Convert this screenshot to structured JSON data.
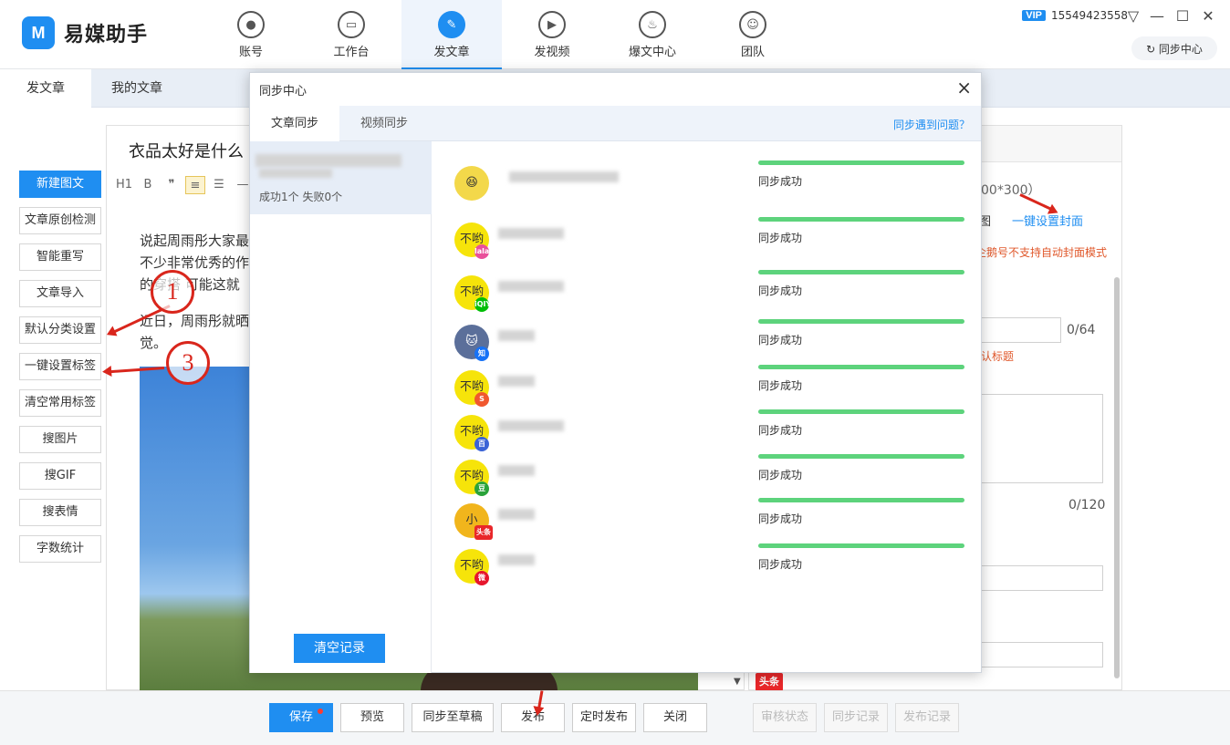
{
  "app": {
    "logo_mark": "M",
    "name": "易媒助手"
  },
  "nav": [
    {
      "label": "账号",
      "icon": "user-icon",
      "glyph": "●",
      "active": false
    },
    {
      "label": "工作台",
      "icon": "monitor-icon",
      "glyph": "▭",
      "active": false
    },
    {
      "label": "发文章",
      "icon": "feather-icon",
      "glyph": "✎",
      "active": true
    },
    {
      "label": "发视频",
      "icon": "play-icon",
      "glyph": "▶",
      "active": false
    },
    {
      "label": "爆文中心",
      "icon": "flame-icon",
      "glyph": "♨",
      "active": false
    },
    {
      "label": "团队",
      "icon": "team-icon",
      "glyph": "☺",
      "active": false
    }
  ],
  "account": {
    "vip": "VIP",
    "phone": "15549423558"
  },
  "window": {
    "menu": "▽",
    "minimize": "—",
    "maximize": "☐",
    "close": "✕"
  },
  "sync_center_button": "↻ 同步中心",
  "subtabs": [
    "发文章",
    "我的文章"
  ],
  "tools": [
    "新建图文",
    "文章原创检测",
    "智能重写",
    "文章导入",
    "默认分类设置",
    "一键设置标签",
    "清空常用标签",
    "搜图片",
    "搜GIF",
    "搜表情",
    "字数统计"
  ],
  "editor": {
    "title": "衣品太好是什么",
    "toolbar": [
      "H1",
      "B",
      "❞",
      "≡",
      "☰",
      "—",
      "▢"
    ],
    "para1": [
      "说起周雨彤大家最",
      "不少非常优秀的作",
      "的穿搭 可能这就"
    ],
    "para2": [
      "近日，周雨彤就晒",
      "觉。"
    ]
  },
  "right_panel": {
    "cover_size": "00*300）",
    "cover_tu": "图",
    "cover_link": "一键设置封面",
    "cover_warn": "企鹅号不支持自动封面模式",
    "title_count": "0/64",
    "title_hint": "认标题",
    "summary_count": "0/120",
    "toutiao": "头条"
  },
  "bottom": {
    "save": "保存",
    "preview": "预览",
    "sync_draft": "同步至草稿",
    "publish": "发布",
    "schedule": "定时发布",
    "close": "关闭",
    "review": "审核状态",
    "sync_record": "同步记录",
    "publish_record": "发布记录"
  },
  "annotations": {
    "one": "1",
    "three": "3"
  },
  "dialog": {
    "title": "同步中心",
    "close": "×",
    "tabs": [
      "文章同步",
      "视频同步"
    ],
    "help": "同步遇到问题？",
    "record_stat": "成功1个 失败0个",
    "clear": "清空记录",
    "platforms": [
      {
        "icon": "laughing-emoji-avatar-icon",
        "avatar": "😆",
        "badge": "",
        "status": "同步成功"
      },
      {
        "icon": "platform-avatar-icon",
        "avatar": "不哟",
        "badge": "lala",
        "status": "同步成功"
      },
      {
        "icon": "iqiyi-avatar-icon",
        "avatar": "不哟",
        "badge": "iQIYI",
        "status": "同步成功"
      },
      {
        "icon": "zhihu-avatar-icon",
        "avatar": "🐱",
        "badge": "知",
        "status": "同步成功"
      },
      {
        "icon": "sohu-avatar-icon",
        "avatar": "不哟",
        "badge": "S",
        "status": "同步成功"
      },
      {
        "icon": "baijia-avatar-icon",
        "avatar": "不哟",
        "badge": "百",
        "status": "同步成功"
      },
      {
        "icon": "douban-avatar-icon",
        "avatar": "不哟",
        "badge": "豆",
        "status": "同步成功"
      },
      {
        "icon": "toutiao-avatar-icon",
        "avatar": "小",
        "badge": "头条",
        "status": "同步成功"
      },
      {
        "icon": "weibo-avatar-icon",
        "avatar": "不哟",
        "badge": "微",
        "status": "同步成功"
      }
    ]
  },
  "colors": {
    "accent": "#1f8ef1",
    "success": "#5dd37c",
    "annotation": "#d9261c",
    "warning": "#e0582b"
  }
}
